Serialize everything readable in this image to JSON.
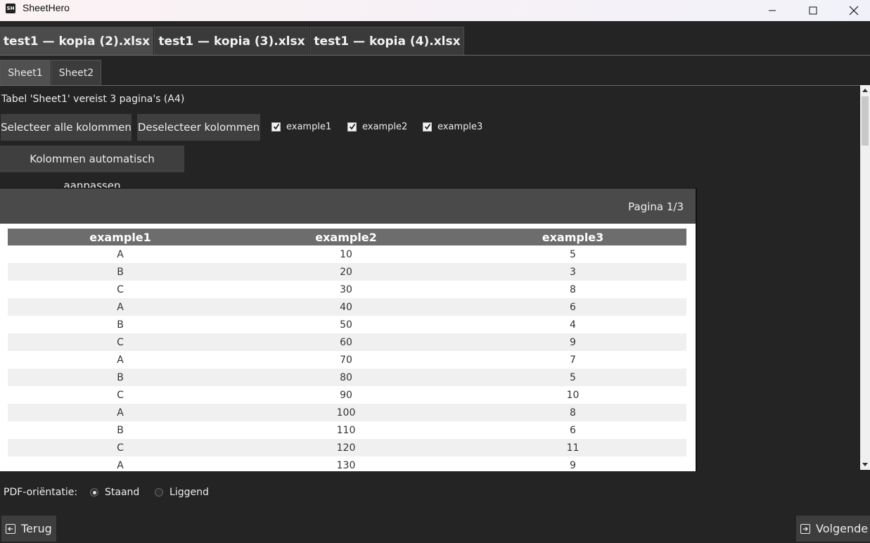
{
  "window": {
    "app_icon_text": "SH",
    "title": "SheetHero"
  },
  "file_tabs": [
    {
      "label": "test1 — kopia (2).xlsx",
      "active": true
    },
    {
      "label": "test1 — kopia (3).xlsx",
      "active": false
    },
    {
      "label": "test1 — kopia (4).xlsx",
      "active": false
    }
  ],
  "sheet_tabs": [
    {
      "label": "Sheet1",
      "active": true
    },
    {
      "label": "Sheet2",
      "active": false
    }
  ],
  "info_text": "Tabel 'Sheet1' vereist 3 pagina's (A4)",
  "buttons": {
    "select_all": "Selecteer alle kolommen",
    "deselect": "Deselecteer kolommen",
    "autofit": "Kolommen automatisch aanpassen"
  },
  "columns": [
    {
      "label": "example1",
      "checked": true
    },
    {
      "label": "example2",
      "checked": true
    },
    {
      "label": "example3",
      "checked": true
    }
  ],
  "preview": {
    "page_label": "Pagina 1/3",
    "headers": [
      "example1",
      "example2",
      "example3"
    ],
    "rows": [
      [
        "A",
        "10",
        "5"
      ],
      [
        "B",
        "20",
        "3"
      ],
      [
        "C",
        "30",
        "8"
      ],
      [
        "A",
        "40",
        "6"
      ],
      [
        "B",
        "50",
        "4"
      ],
      [
        "C",
        "60",
        "9"
      ],
      [
        "A",
        "70",
        "7"
      ],
      [
        "B",
        "80",
        "5"
      ],
      [
        "C",
        "90",
        "10"
      ],
      [
        "A",
        "100",
        "8"
      ],
      [
        "B",
        "110",
        "6"
      ],
      [
        "C",
        "120",
        "11"
      ],
      [
        "A",
        "130",
        "9"
      ]
    ]
  },
  "orientation": {
    "label": "PDF-oriëntatie:",
    "options": [
      {
        "label": "Staand",
        "selected": true
      },
      {
        "label": "Liggend",
        "selected": false
      }
    ]
  },
  "nav": {
    "back": "Terug",
    "next": "Volgende"
  }
}
